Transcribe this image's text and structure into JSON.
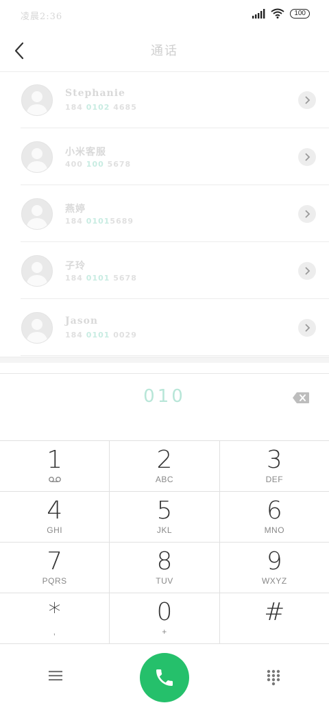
{
  "status_bar": {
    "time": "凌晨2:36",
    "battery": "100"
  },
  "header": {
    "title": "通话"
  },
  "contacts": [
    {
      "name": "Stephanie",
      "phone_pre": "184 ",
      "phone_match": "0102",
      "phone_post": " 4685"
    },
    {
      "name": "小米客服",
      "phone_pre": "400 ",
      "phone_match": "100",
      "phone_post": " 5678"
    },
    {
      "name": "燕婷",
      "phone_pre": "184 ",
      "phone_match": "0101",
      "phone_post": "5689"
    },
    {
      "name": "子玲",
      "phone_pre": "184 ",
      "phone_match": "0101",
      "phone_post": " 5678"
    },
    {
      "name": "Jason",
      "phone_pre": "184 ",
      "phone_match": "0101",
      "phone_post": " 0029"
    }
  ],
  "dial": {
    "display": "010"
  },
  "keypad": [
    [
      {
        "digit": "1",
        "letters": ""
      },
      {
        "digit": "2",
        "letters": "ABC"
      },
      {
        "digit": "3",
        "letters": "DEF"
      }
    ],
    [
      {
        "digit": "4",
        "letters": "GHI"
      },
      {
        "digit": "5",
        "letters": "JKL"
      },
      {
        "digit": "6",
        "letters": "MNO"
      }
    ],
    [
      {
        "digit": "7",
        "letters": "PQRS"
      },
      {
        "digit": "8",
        "letters": "TUV"
      },
      {
        "digit": "9",
        "letters": "WXYZ"
      }
    ],
    [
      {
        "digit": "*",
        "letters": ","
      },
      {
        "digit": "0",
        "letters": "+"
      },
      {
        "digit": "#",
        "letters": ""
      }
    ]
  ],
  "colors": {
    "call_green": "#25c06b",
    "match_highlight": "#b8e6d8"
  },
  "icons": {
    "back": "back-arrow-icon",
    "chevron": "chevron-right-icon",
    "backspace": "backspace-icon",
    "voicemail": "voicemail-icon",
    "menu": "menu-icon",
    "call": "phone-icon",
    "dialpad": "dialpad-icon"
  }
}
